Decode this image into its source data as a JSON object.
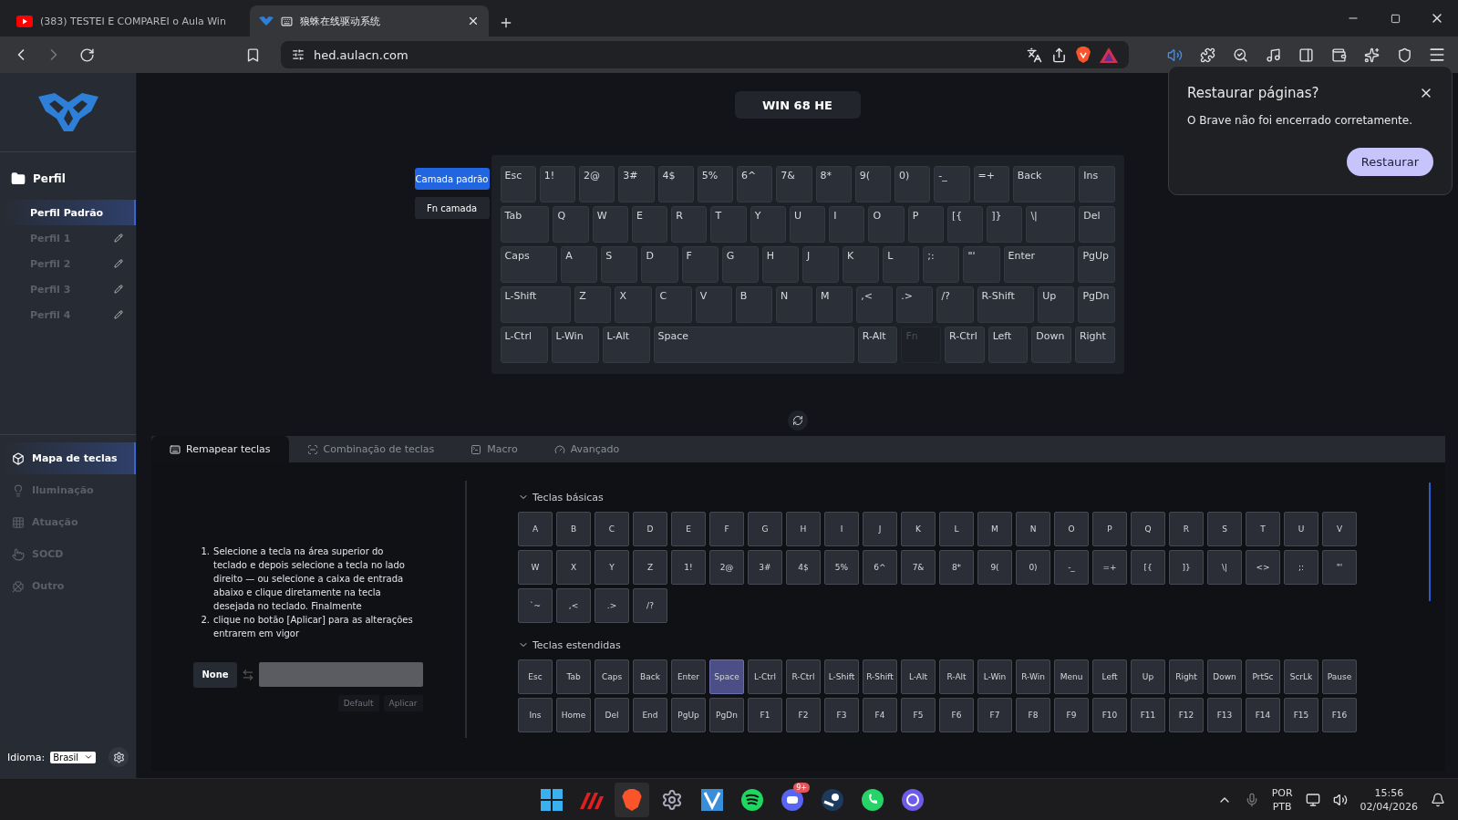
{
  "browser": {
    "tabs": [
      {
        "title": "(383) TESTEI E COMPAREI o Aula Win",
        "selected": false
      },
      {
        "title": "狼蛛在线驱动系统",
        "selected": true
      }
    ],
    "address": "hed.aulacn.com"
  },
  "restore_popup": {
    "title": "Restaurar páginas?",
    "message": "O Brave não foi encerrado corretamente.",
    "button": "Restaurar"
  },
  "sidebar": {
    "profile_header": "Perfil",
    "profiles": [
      {
        "label": "Perfil Padrão",
        "selected": true
      },
      {
        "label": "Perfil 1",
        "selected": false
      },
      {
        "label": "Perfil 2",
        "selected": false
      },
      {
        "label": "Perfil 3",
        "selected": false
      },
      {
        "label": "Perfil 4",
        "selected": false
      }
    ],
    "menu": [
      {
        "label": "Mapa de teclas",
        "kind": "cube",
        "selected": true
      },
      {
        "label": "Iluminação",
        "kind": "bulb",
        "selected": false
      },
      {
        "label": "Atuação",
        "kind": "dots",
        "selected": false
      },
      {
        "label": "SOCD",
        "kind": "hand",
        "selected": false
      },
      {
        "label": "Outro",
        "kind": "clover",
        "selected": false
      }
    ],
    "language_label": "Idioma:",
    "language": "Brasil"
  },
  "device_title": "WIN 68 HE",
  "layers": [
    {
      "label": "Camada padrão",
      "selected": true
    },
    {
      "label": "Fn camada",
      "selected": false
    }
  ],
  "keyboard_rows": [
    [
      {
        "label": "Esc",
        "kind": "u1"
      },
      {
        "label": "1!",
        "kind": "u1"
      },
      {
        "label": "2@",
        "kind": "u1"
      },
      {
        "label": "3#",
        "kind": "u1"
      },
      {
        "label": "4$",
        "kind": "u1"
      },
      {
        "label": "5%",
        "kind": "u1"
      },
      {
        "label": "6^",
        "kind": "u1"
      },
      {
        "label": "7&",
        "kind": "u1"
      },
      {
        "label": "8*",
        "kind": "u1"
      },
      {
        "label": "9(",
        "kind": "u1"
      },
      {
        "label": "0)",
        "kind": "u1"
      },
      {
        "label": "-_",
        "kind": "u1"
      },
      {
        "label": "=+",
        "kind": "u1"
      },
      {
        "label": "Back",
        "kind": "u2"
      },
      {
        "label": "Ins",
        "kind": "u1"
      }
    ],
    [
      {
        "label": "Tab",
        "kind": "u15"
      },
      {
        "label": "Q",
        "kind": "u1"
      },
      {
        "label": "W",
        "kind": "u1"
      },
      {
        "label": "E",
        "kind": "u1"
      },
      {
        "label": "R",
        "kind": "u1"
      },
      {
        "label": "T",
        "kind": "u1"
      },
      {
        "label": "Y",
        "kind": "u1"
      },
      {
        "label": "U",
        "kind": "u1"
      },
      {
        "label": "I",
        "kind": "u1"
      },
      {
        "label": "O",
        "kind": "u1"
      },
      {
        "label": "P",
        "kind": "u1"
      },
      {
        "label": "[{",
        "kind": "u1"
      },
      {
        "label": "]}",
        "kind": "u1"
      },
      {
        "label": "\\|",
        "kind": "u15"
      },
      {
        "label": "Del",
        "kind": "u1"
      }
    ],
    [
      {
        "label": "Caps",
        "kind": "u175"
      },
      {
        "label": "A",
        "kind": "u1"
      },
      {
        "label": "S",
        "kind": "u1"
      },
      {
        "label": "D",
        "kind": "u1"
      },
      {
        "label": "F",
        "kind": "u1"
      },
      {
        "label": "G",
        "kind": "u1"
      },
      {
        "label": "H",
        "kind": "u1"
      },
      {
        "label": "J",
        "kind": "u1"
      },
      {
        "label": "K",
        "kind": "u1"
      },
      {
        "label": "L",
        "kind": "u1"
      },
      {
        "label": ";:",
        "kind": "u1"
      },
      {
        "label": "\"'",
        "kind": "u1"
      },
      {
        "label": "Enter",
        "kind": "u225"
      },
      {
        "label": "PgUp",
        "kind": "u1"
      }
    ],
    [
      {
        "label": "L-Shift",
        "kind": "u225"
      },
      {
        "label": "Z",
        "kind": "u1"
      },
      {
        "label": "X",
        "kind": "u1"
      },
      {
        "label": "C",
        "kind": "u1"
      },
      {
        "label": "V",
        "kind": "u1"
      },
      {
        "label": "B",
        "kind": "u1"
      },
      {
        "label": "N",
        "kind": "u1"
      },
      {
        "label": "M",
        "kind": "u1"
      },
      {
        "label": ",<",
        "kind": "u1"
      },
      {
        "label": ".>",
        "kind": "u1"
      },
      {
        "label": "/?",
        "kind": "u1"
      },
      {
        "label": "R-Shift",
        "kind": "u175"
      },
      {
        "label": "Up",
        "kind": "u1"
      },
      {
        "label": "PgDn",
        "kind": "u1"
      }
    ],
    [
      {
        "label": "L-Ctrl",
        "kind": "u125"
      },
      {
        "label": "L-Win",
        "kind": "u125"
      },
      {
        "label": "L-Alt",
        "kind": "u125"
      },
      {
        "label": "Space",
        "kind": "u625"
      },
      {
        "label": "R-Alt",
        "kind": "u1"
      },
      {
        "label": "Fn",
        "kind": "dim"
      },
      {
        "label": "R-Ctrl",
        "kind": "u1"
      },
      {
        "label": "Left",
        "kind": "u1"
      },
      {
        "label": "Down",
        "kind": "u1"
      },
      {
        "label": "Right",
        "kind": "u1"
      }
    ]
  ],
  "remap_tabs": [
    {
      "label": "Remapear teclas",
      "kind": "keyboard",
      "selected": true
    },
    {
      "label": "Combinação de teclas",
      "kind": "combo",
      "selected": false
    },
    {
      "label": "Macro",
      "kind": "terminal",
      "selected": false
    },
    {
      "label": "Avançado",
      "kind": "gauge",
      "selected": false
    }
  ],
  "instructions": [
    {
      "number": "1.",
      "text": "Selecione a tecla na área superior do teclado e depois selecione a tecla no lado direito — ou selecione a caixa de entrada abaixo e clique diretamente na tecla desejada no teclado. Finalmente"
    },
    {
      "number": "2.",
      "text": "clique no botão [Aplicar] para as alterações entrarem em vigor"
    }
  ],
  "remap": {
    "source_key": "None",
    "buttons": [
      "Default",
      "Aplicar"
    ]
  },
  "key_groups": [
    {
      "title": "Teclas básicas",
      "expanded": true,
      "keys": [
        {
          "label": "A",
          "selected": false
        },
        {
          "label": "B",
          "selected": false
        },
        {
          "label": "C",
          "selected": false
        },
        {
          "label": "D",
          "selected": false
        },
        {
          "label": "E",
          "selected": false
        },
        {
          "label": "F",
          "selected": false
        },
        {
          "label": "G",
          "selected": false
        },
        {
          "label": "H",
          "selected": false
        },
        {
          "label": "I",
          "selected": false
        },
        {
          "label": "J",
          "selected": false
        },
        {
          "label": "K",
          "selected": false
        },
        {
          "label": "L",
          "selected": false
        },
        {
          "label": "M",
          "selected": false
        },
        {
          "label": "N",
          "selected": false
        },
        {
          "label": "O",
          "selected": false
        },
        {
          "label": "P",
          "selected": false
        },
        {
          "label": "Q",
          "selected": false
        },
        {
          "label": "R",
          "selected": false
        },
        {
          "label": "S",
          "selected": false
        },
        {
          "label": "T",
          "selected": false
        },
        {
          "label": "U",
          "selected": false
        },
        {
          "label": "V",
          "selected": false
        },
        {
          "label": "W",
          "selected": false
        },
        {
          "label": "X",
          "selected": false
        },
        {
          "label": "Y",
          "selected": false
        },
        {
          "label": "Z",
          "selected": false
        },
        {
          "label": "1!",
          "selected": false
        },
        {
          "label": "2@",
          "selected": false
        },
        {
          "label": "3#",
          "selected": false
        },
        {
          "label": "4$",
          "selected": false
        },
        {
          "label": "5%",
          "selected": false
        },
        {
          "label": "6^",
          "selected": false
        },
        {
          "label": "7&",
          "selected": false
        },
        {
          "label": "8*",
          "selected": false
        },
        {
          "label": "9(",
          "selected": false
        },
        {
          "label": "0)",
          "selected": false
        },
        {
          "label": "-_",
          "selected": false
        },
        {
          "label": "=+",
          "selected": false
        },
        {
          "label": "[{",
          "selected": false
        },
        {
          "label": "]}",
          "selected": false
        },
        {
          "label": "\\|",
          "selected": false
        },
        {
          "label": "<>",
          "selected": false
        },
        {
          "label": ";:",
          "selected": false
        },
        {
          "label": "\"'",
          "selected": false
        },
        {
          "label": "`~",
          "selected": false
        },
        {
          "label": ",<",
          "selected": false
        },
        {
          "label": ".>",
          "selected": false
        },
        {
          "label": "/?",
          "selected": false
        }
      ]
    },
    {
      "title": "Teclas estendidas",
      "expanded": true,
      "keys": [
        {
          "label": "Esc",
          "selected": false
        },
        {
          "label": "Tab",
          "selected": false
        },
        {
          "label": "Caps",
          "selected": false
        },
        {
          "label": "Back",
          "selected": false
        },
        {
          "label": "Enter",
          "selected": false
        },
        {
          "label": "Space",
          "selected": true
        },
        {
          "label": "L-Ctrl",
          "selected": false
        },
        {
          "label": "R-Ctrl",
          "selected": false
        },
        {
          "label": "L-Shift",
          "selected": false
        },
        {
          "label": "R-Shift",
          "selected": false
        },
        {
          "label": "L-Alt",
          "selected": false
        },
        {
          "label": "R-Alt",
          "selected": false
        },
        {
          "label": "L-Win",
          "selected": false
        },
        {
          "label": "R-Win",
          "selected": false
        },
        {
          "label": "Menu",
          "selected": false
        },
        {
          "label": "Left",
          "selected": false
        },
        {
          "label": "Up",
          "selected": false
        },
        {
          "label": "Right",
          "selected": false
        },
        {
          "label": "Down",
          "selected": false
        },
        {
          "label": "PrtSc",
          "selected": false
        },
        {
          "label": "ScrLk",
          "selected": false
        },
        {
          "label": "Pause",
          "selected": false
        },
        {
          "label": "Ins",
          "selected": false
        },
        {
          "label": "Home",
          "selected": false
        },
        {
          "label": "Del",
          "selected": false
        },
        {
          "label": "End",
          "selected": false
        },
        {
          "label": "PgUp",
          "selected": false
        },
        {
          "label": "PgDn",
          "selected": false
        },
        {
          "label": "F1",
          "selected": false
        },
        {
          "label": "F2",
          "selected": false
        },
        {
          "label": "F3",
          "selected": false
        },
        {
          "label": "F4",
          "selected": false
        },
        {
          "label": "F5",
          "selected": false
        },
        {
          "label": "F6",
          "selected": false
        },
        {
          "label": "F7",
          "selected": false
        },
        {
          "label": "F8",
          "selected": false
        },
        {
          "label": "F9",
          "selected": false
        },
        {
          "label": "F10",
          "selected": false
        },
        {
          "label": "F11",
          "selected": false
        },
        {
          "label": "F12",
          "selected": false
        },
        {
          "label": "F13",
          "selected": false
        },
        {
          "label": "F14",
          "selected": false
        },
        {
          "label": "F15",
          "selected": false
        },
        {
          "label": "F16",
          "selected": false
        }
      ]
    }
  ],
  "taskbar": {
    "badge": "9+",
    "language": "POR",
    "layout": "PTB",
    "time": "15:56",
    "date": "02/04/2026"
  }
}
